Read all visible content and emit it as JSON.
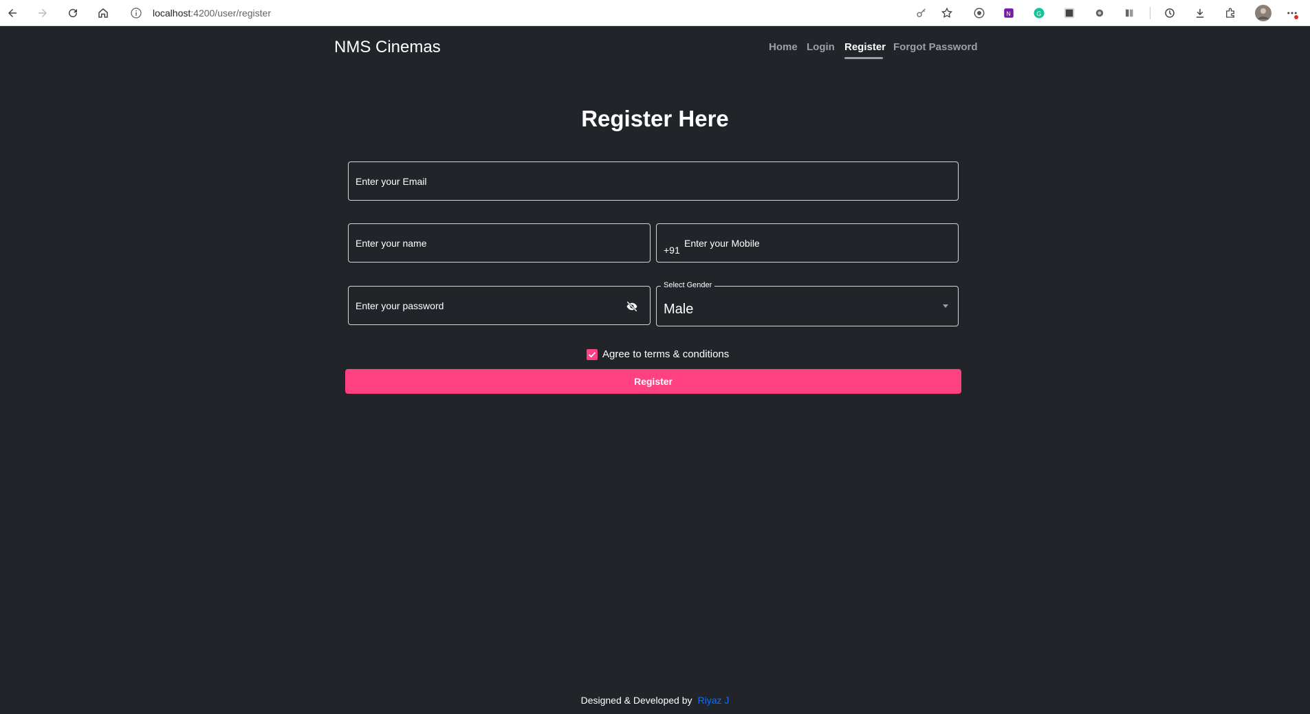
{
  "browser": {
    "url_host": "localhost",
    "url_path": ":4200/user/register"
  },
  "header": {
    "brand": "NMS Cinemas",
    "nav": [
      {
        "label": "Home"
      },
      {
        "label": "Login"
      },
      {
        "label": "Register",
        "active": true
      },
      {
        "label": "Forgot Password"
      }
    ]
  },
  "form": {
    "title": "Register Here",
    "email_placeholder": "Enter your Email",
    "name_placeholder": "Enter your name",
    "mobile_prefix": "+91",
    "mobile_placeholder": "Enter your Mobile",
    "password_placeholder": "Enter your password",
    "gender_label": "Select Gender",
    "gender_value": "Male",
    "terms_label": "Agree to terms & conditions",
    "terms_checked": true,
    "submit_label": "Register"
  },
  "footer": {
    "text": "Designed & Developed by",
    "author": "Riyaz J"
  },
  "colors": {
    "background": "#212529",
    "accent": "#ff4081",
    "link": "#0d6efd"
  }
}
